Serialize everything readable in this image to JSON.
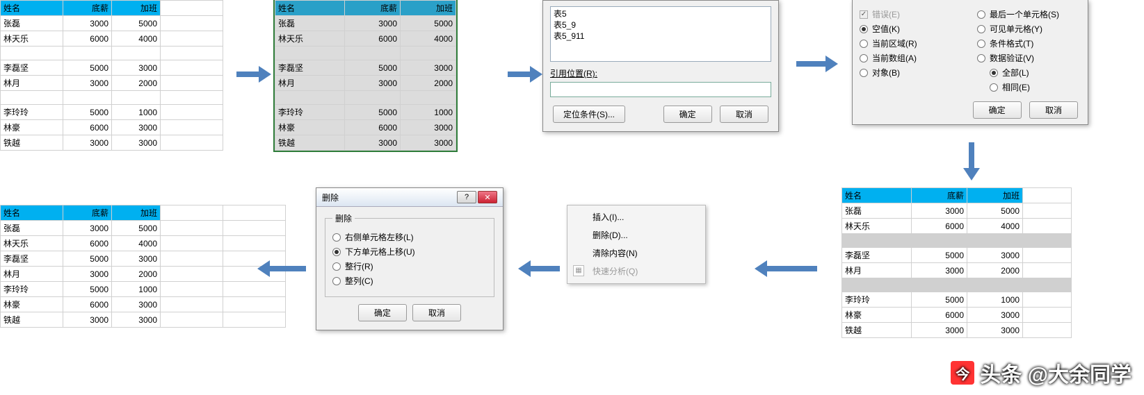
{
  "headers": {
    "c1": "姓名",
    "c2": "底薪",
    "c3": "加班"
  },
  "tableA": [
    [
      "张磊",
      3000,
      5000
    ],
    [
      "林天乐",
      6000,
      4000
    ],
    [
      "",
      "",
      ""
    ],
    [
      "李磊坚",
      5000,
      3000
    ],
    [
      "林月",
      3000,
      2000
    ],
    [
      "",
      "",
      ""
    ],
    [
      "李玲玲",
      5000,
      1000
    ],
    [
      "林豪",
      6000,
      3000
    ],
    [
      "铁越",
      3000,
      3000
    ]
  ],
  "tableFinal": [
    [
      "张磊",
      3000,
      5000
    ],
    [
      "林天乐",
      6000,
      4000
    ],
    [
      "李磊坚",
      5000,
      3000
    ],
    [
      "林月",
      3000,
      2000
    ],
    [
      "李玲玲",
      5000,
      1000
    ],
    [
      "林豪",
      6000,
      3000
    ],
    [
      "铁越",
      3000,
      3000
    ]
  ],
  "gotoDlg": {
    "list": [
      "表5",
      "表5_9",
      "表5_911"
    ],
    "refLabel": "引用位置(R):",
    "btnCond": "定位条件(S)...",
    "btnOk": "确定",
    "btnCancel": "取消"
  },
  "specialDlg": {
    "col1": [
      {
        "type": "check",
        "label": "错误(E)",
        "disabled": true,
        "sel": true
      },
      {
        "type": "radio",
        "label": "空值(K)",
        "sel": true
      },
      {
        "type": "radio",
        "label": "当前区域(R)"
      },
      {
        "type": "radio",
        "label": "当前数组(A)"
      },
      {
        "type": "radio",
        "label": "对象(B)"
      }
    ],
    "col2": [
      {
        "type": "radio",
        "label": "最后一个单元格(S)"
      },
      {
        "type": "radio",
        "label": "可见单元格(Y)"
      },
      {
        "type": "radio",
        "label": "条件格式(T)"
      },
      {
        "type": "radio",
        "label": "数据验证(V)"
      },
      {
        "type": "radio",
        "label": "全部(L)",
        "sel": true,
        "sub": true
      },
      {
        "type": "radio",
        "label": "相同(E)",
        "sub": true
      }
    ],
    "btnOk": "确定",
    "btnCancel": "取消"
  },
  "ctx": {
    "insert": "插入(I)...",
    "delete": "删除(D)...",
    "clear": "清除内容(N)",
    "quick": "快速分析(Q)"
  },
  "deleteDlg": {
    "title": "删除",
    "group": "删除",
    "opt1": "右侧单元格左移(L)",
    "opt2": "下方单元格上移(U)",
    "opt3": "整行(R)",
    "opt4": "整列(C)",
    "btnOk": "确定",
    "btnCancel": "取消"
  },
  "watermark": "头条 @大余同学"
}
